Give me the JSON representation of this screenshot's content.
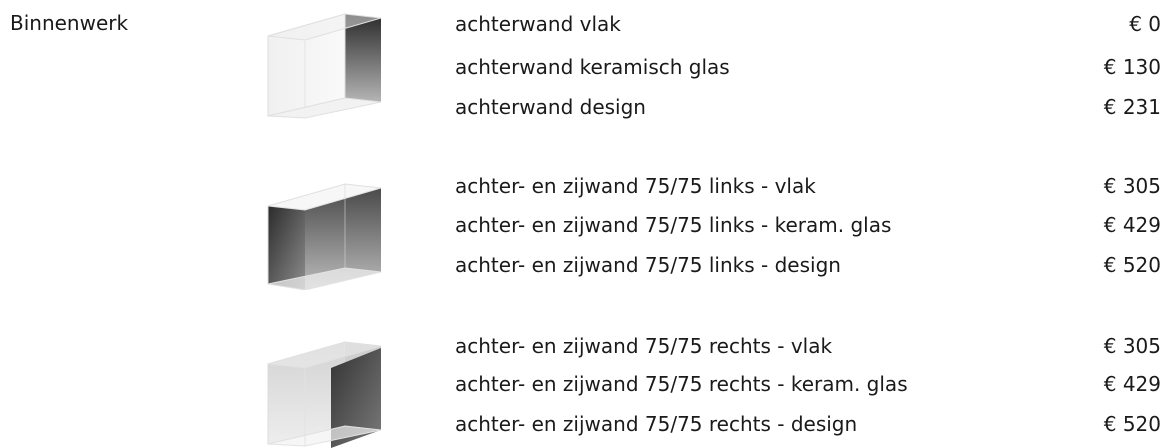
{
  "section": {
    "label": "Binnenwerk"
  },
  "groups": [
    {
      "icon": "back-wall-icon",
      "options": [
        {
          "name": "achterwand vlak",
          "price": "€ 0"
        },
        {
          "name": "achterwand keramisch glas",
          "price": "€ 130"
        },
        {
          "name": "achterwand design",
          "price": "€ 231"
        }
      ]
    },
    {
      "icon": "back-and-left-side-wall-icon",
      "options": [
        {
          "name": "achter- en zijwand 75/75 links - vlak",
          "price": "€ 305"
        },
        {
          "name": "achter- en zijwand 75/75 links - keram. glas",
          "price": "€ 429"
        },
        {
          "name": "achter- en zijwand 75/75 links - design",
          "price": "€ 520"
        }
      ]
    },
    {
      "icon": "back-and-right-side-wall-icon",
      "options": [
        {
          "name": "achter- en zijwand 75/75 rechts - vlak",
          "price": "€ 305"
        },
        {
          "name": "achter- en zijwand 75/75 rechts - keram. glas",
          "price": "€ 429"
        },
        {
          "name": "achter- en zijwand 75/75 rechts - design",
          "price": "€ 520"
        }
      ]
    }
  ]
}
